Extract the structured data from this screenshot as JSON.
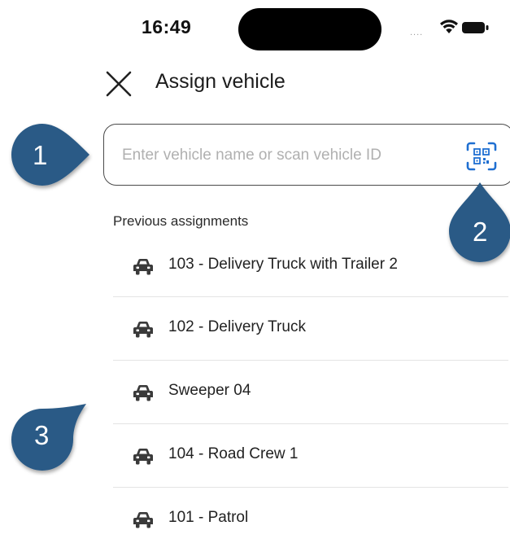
{
  "status_bar": {
    "time": "16:49",
    "signal": "....",
    "icons": [
      "wifi-icon",
      "battery-icon"
    ]
  },
  "header": {
    "close_icon": "close-icon",
    "title": "Assign vehicle"
  },
  "search": {
    "placeholder": "Enter vehicle name or scan vehicle ID",
    "value": "",
    "scan_icon": "qr-scan-icon",
    "accent_color": "#1f6fd1"
  },
  "previous_assignments": {
    "label": "Previous assignments",
    "icon": "car-icon",
    "items": [
      {
        "name": "103 - Delivery Truck with Trailer 2"
      },
      {
        "name": "102 - Delivery Truck"
      },
      {
        "name": "Sweeper 04"
      },
      {
        "name": "104 - Road Crew 1"
      },
      {
        "name": "101 - Patrol"
      }
    ]
  },
  "callouts": {
    "color": "#2a5a86",
    "items": [
      "1",
      "2",
      "3"
    ]
  }
}
